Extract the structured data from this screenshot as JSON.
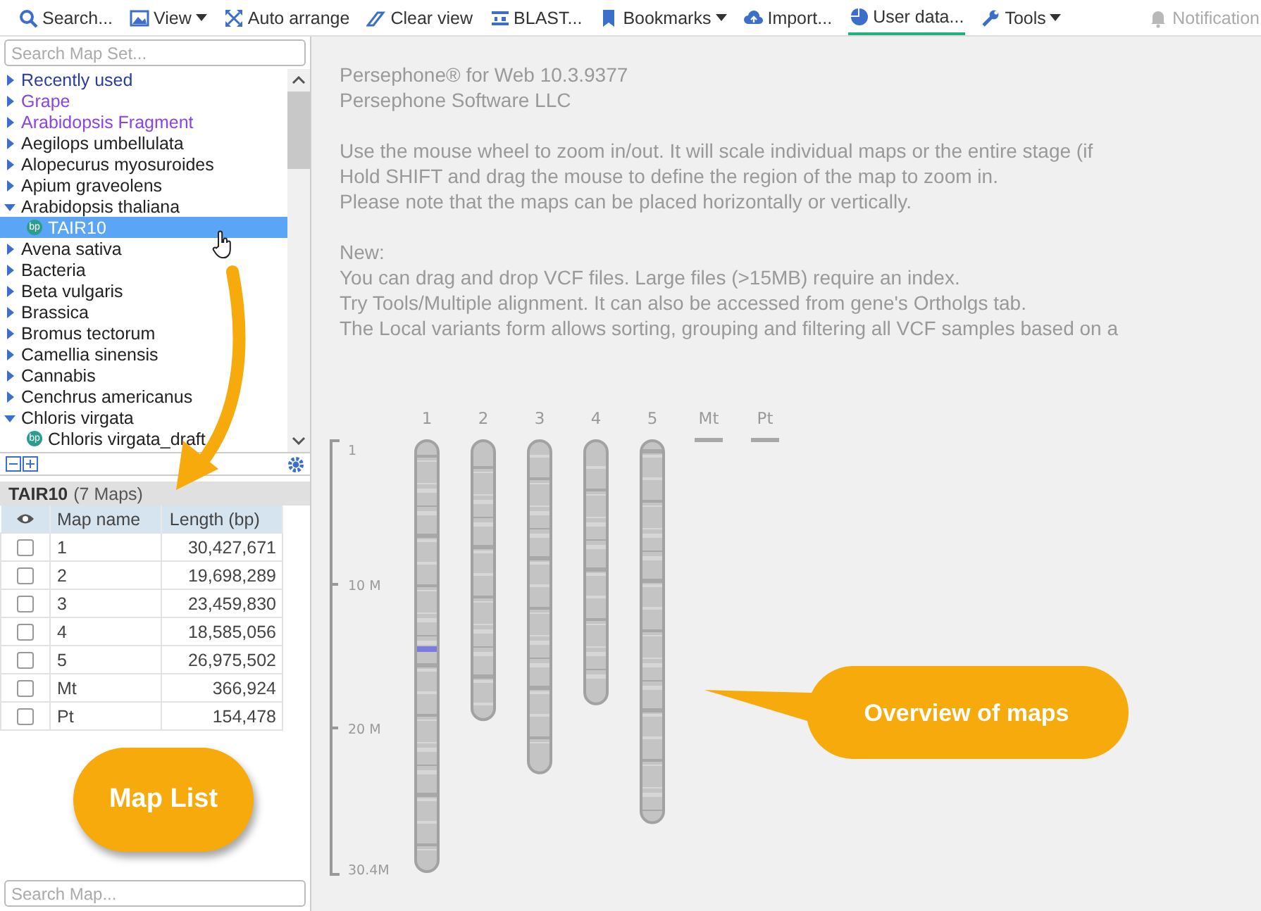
{
  "toolbar": [
    {
      "label": "Search...",
      "kind": "search",
      "dropdown": false,
      "selected": false,
      "disabled": false
    },
    {
      "label": "View",
      "kind": "image",
      "dropdown": true,
      "selected": false,
      "disabled": false
    },
    {
      "label": "Auto arrange",
      "kind": "arrows",
      "dropdown": false,
      "selected": false,
      "disabled": false
    },
    {
      "label": "Clear view",
      "kind": "eraser",
      "dropdown": false,
      "selected": false,
      "disabled": false
    },
    {
      "label": "BLAST...",
      "kind": "align",
      "dropdown": false,
      "selected": false,
      "disabled": false
    },
    {
      "label": "Bookmarks",
      "kind": "bookmark",
      "dropdown": true,
      "selected": false,
      "disabled": false
    },
    {
      "label": "Import...",
      "kind": "cloud",
      "dropdown": false,
      "selected": false,
      "disabled": false
    },
    {
      "label": "User data...",
      "kind": "pie",
      "dropdown": false,
      "selected": true,
      "disabled": false
    },
    {
      "label": "Tools",
      "kind": "wrench",
      "dropdown": true,
      "selected": false,
      "disabled": false
    },
    {
      "label": "Notification",
      "kind": "bell",
      "dropdown": false,
      "selected": false,
      "disabled": true
    }
  ],
  "tree": {
    "placeholder": "Search Map Set...",
    "items": [
      {
        "label": "Recently used",
        "color": "#2b3d9b",
        "expanded": false,
        "selected": false
      },
      {
        "label": "Grape",
        "color": "#8a44e0",
        "expanded": false,
        "selected": false
      },
      {
        "label": "Arabidopsis Fragment",
        "color": "#8a44e0",
        "expanded": false,
        "selected": false
      },
      {
        "label": "Aegilops umbellulata",
        "color": "#222222",
        "expanded": false,
        "selected": false
      },
      {
        "label": "Alopecurus myosuroides",
        "color": "#222222",
        "expanded": false,
        "selected": false
      },
      {
        "label": "Apium graveolens",
        "color": "#222222",
        "expanded": false,
        "selected": false
      },
      {
        "label": "Arabidopsis thaliana",
        "color": "#222222",
        "expanded": true,
        "selected": false,
        "children": [
          {
            "label": "TAIR10",
            "badge": "bp",
            "selected": true
          }
        ]
      },
      {
        "label": "Avena sativa",
        "color": "#222222",
        "expanded": false,
        "selected": false
      },
      {
        "label": "Bacteria",
        "color": "#222222",
        "expanded": false,
        "selected": false
      },
      {
        "label": "Beta vulgaris",
        "color": "#222222",
        "expanded": false,
        "selected": false
      },
      {
        "label": "Brassica",
        "color": "#222222",
        "expanded": false,
        "selected": false
      },
      {
        "label": "Bromus tectorum",
        "color": "#222222",
        "expanded": false,
        "selected": false
      },
      {
        "label": "Camellia sinensis",
        "color": "#222222",
        "expanded": false,
        "selected": false
      },
      {
        "label": "Cannabis",
        "color": "#222222",
        "expanded": false,
        "selected": false
      },
      {
        "label": "Cenchrus americanus",
        "color": "#222222",
        "expanded": false,
        "selected": false
      },
      {
        "label": "Chloris virgata",
        "color": "#222222",
        "expanded": true,
        "selected": false,
        "children": [
          {
            "label": "Chloris virgata_draft",
            "badge": "bp",
            "selected": false
          }
        ]
      }
    ]
  },
  "map_list": {
    "title": "TAIR10",
    "count": "(7 Maps)",
    "columns": [
      "Map name",
      "Length (bp)"
    ],
    "rows": [
      {
        "checked": false,
        "name": "1",
        "length": "30,427,671"
      },
      {
        "checked": false,
        "name": "2",
        "length": "19,698,289"
      },
      {
        "checked": false,
        "name": "3",
        "length": "23,459,830"
      },
      {
        "checked": false,
        "name": "4",
        "length": "18,585,056"
      },
      {
        "checked": false,
        "name": "5",
        "length": "26,975,502"
      },
      {
        "checked": false,
        "name": "Mt",
        "length": "366,924"
      },
      {
        "checked": false,
        "name": "Pt",
        "length": "154,478"
      }
    ],
    "placeholder": "Search Map..."
  },
  "info": [
    [
      "Persephone® for Web 10.3.9377",
      "Persephone Software LLC"
    ],
    [
      "Use the mouse wheel to zoom in/out. It will scale individual maps or the entire stage (if",
      "Hold SHIFT and drag the mouse to define the region of the map to zoom in.",
      "Please note that the maps can be placed horizontally or vertically."
    ],
    [
      "New:",
      "You can drag and drop VCF files. Large files (>15MB) require an index.",
      "Try Tools/Multiple alignment. It can also be accessed from gene's Ortholgs tab.",
      "The Local variants form allows sorting, grouping and filtering all VCF samples based on a"
    ]
  ],
  "overview": {
    "scale": [
      "1",
      "10 M",
      "20 M",
      "30.4M"
    ],
    "maps": [
      "1",
      "2",
      "3",
      "4",
      "5",
      "Mt",
      "Pt"
    ]
  },
  "map_list_callout": "Map List",
  "overview_callout": "Overview of maps"
}
